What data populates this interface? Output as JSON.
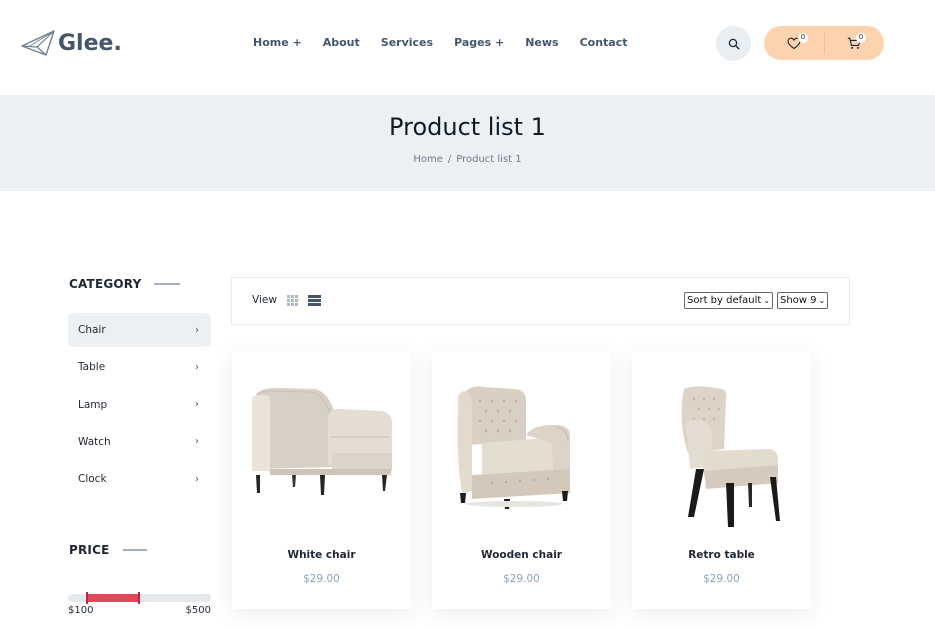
{
  "brand": {
    "name": "Glee."
  },
  "nav": [
    {
      "label": "Home +"
    },
    {
      "label": "About"
    },
    {
      "label": "Services"
    },
    {
      "label": "Pages +"
    },
    {
      "label": "News"
    },
    {
      "label": "Contact"
    }
  ],
  "header_actions": {
    "search_icon": "search-icon",
    "wishlist_count": "0",
    "cart_count": "0",
    "accent_color": "#fcd3ae"
  },
  "banner": {
    "title": "Product list 1",
    "breadcrumb": {
      "home": "Home",
      "separator": "/",
      "current": "Product list 1"
    }
  },
  "sidebar": {
    "category_title": "CATEGORY",
    "categories": [
      {
        "label": "Chair",
        "active": true
      },
      {
        "label": "Table",
        "active": false
      },
      {
        "label": "Lamp",
        "active": false
      },
      {
        "label": "Watch",
        "active": false
      },
      {
        "label": "Clock",
        "active": false
      }
    ],
    "price_title": "PRICE",
    "price_min": "$100",
    "price_max": "$500",
    "range_color": "#e2485a"
  },
  "toolbar": {
    "view_label": "View",
    "sort_value": "Sort by default",
    "show_value": "Show 9"
  },
  "products": [
    {
      "name": "White chair",
      "price": "$29.00"
    },
    {
      "name": "Wooden chair",
      "price": "$29.00"
    },
    {
      "name": "Retro table",
      "price": "$29.00"
    }
  ]
}
